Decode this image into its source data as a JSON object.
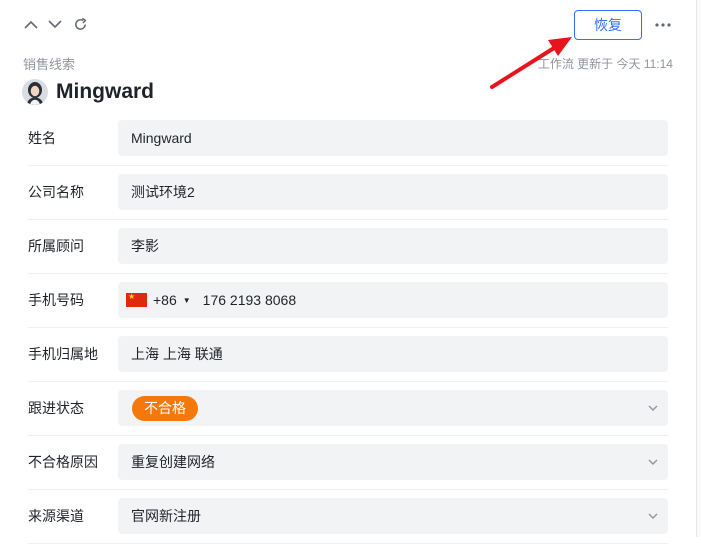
{
  "toolbar": {
    "restore_label": "恢复"
  },
  "record": {
    "breadcrumb": "销售线索",
    "name": "Mingward",
    "updated_text": "工作流 更新于 今天 11:14"
  },
  "fields": [
    {
      "label": "姓名",
      "value": "Mingward"
    },
    {
      "label": "公司名称",
      "value": "测试环境2"
    },
    {
      "label": "所属顾问",
      "value": "李影"
    },
    {
      "label": "手机号码",
      "country_code": "+86",
      "value": "176 2193 8068",
      "flag": "cn-flag-icon"
    },
    {
      "label": "手机归属地",
      "value": "上海 上海 联通"
    },
    {
      "label": "跟进状态",
      "value": "不合格",
      "tag_color": "#f5780a"
    },
    {
      "label": "不合格原因",
      "value": "重复创建网络"
    },
    {
      "label": "来源渠道",
      "value": "官网新注册"
    }
  ],
  "colors": {
    "accent": "#3370ff",
    "field_bg": "#f2f3f5",
    "annotation_arrow": "#e8141b"
  }
}
